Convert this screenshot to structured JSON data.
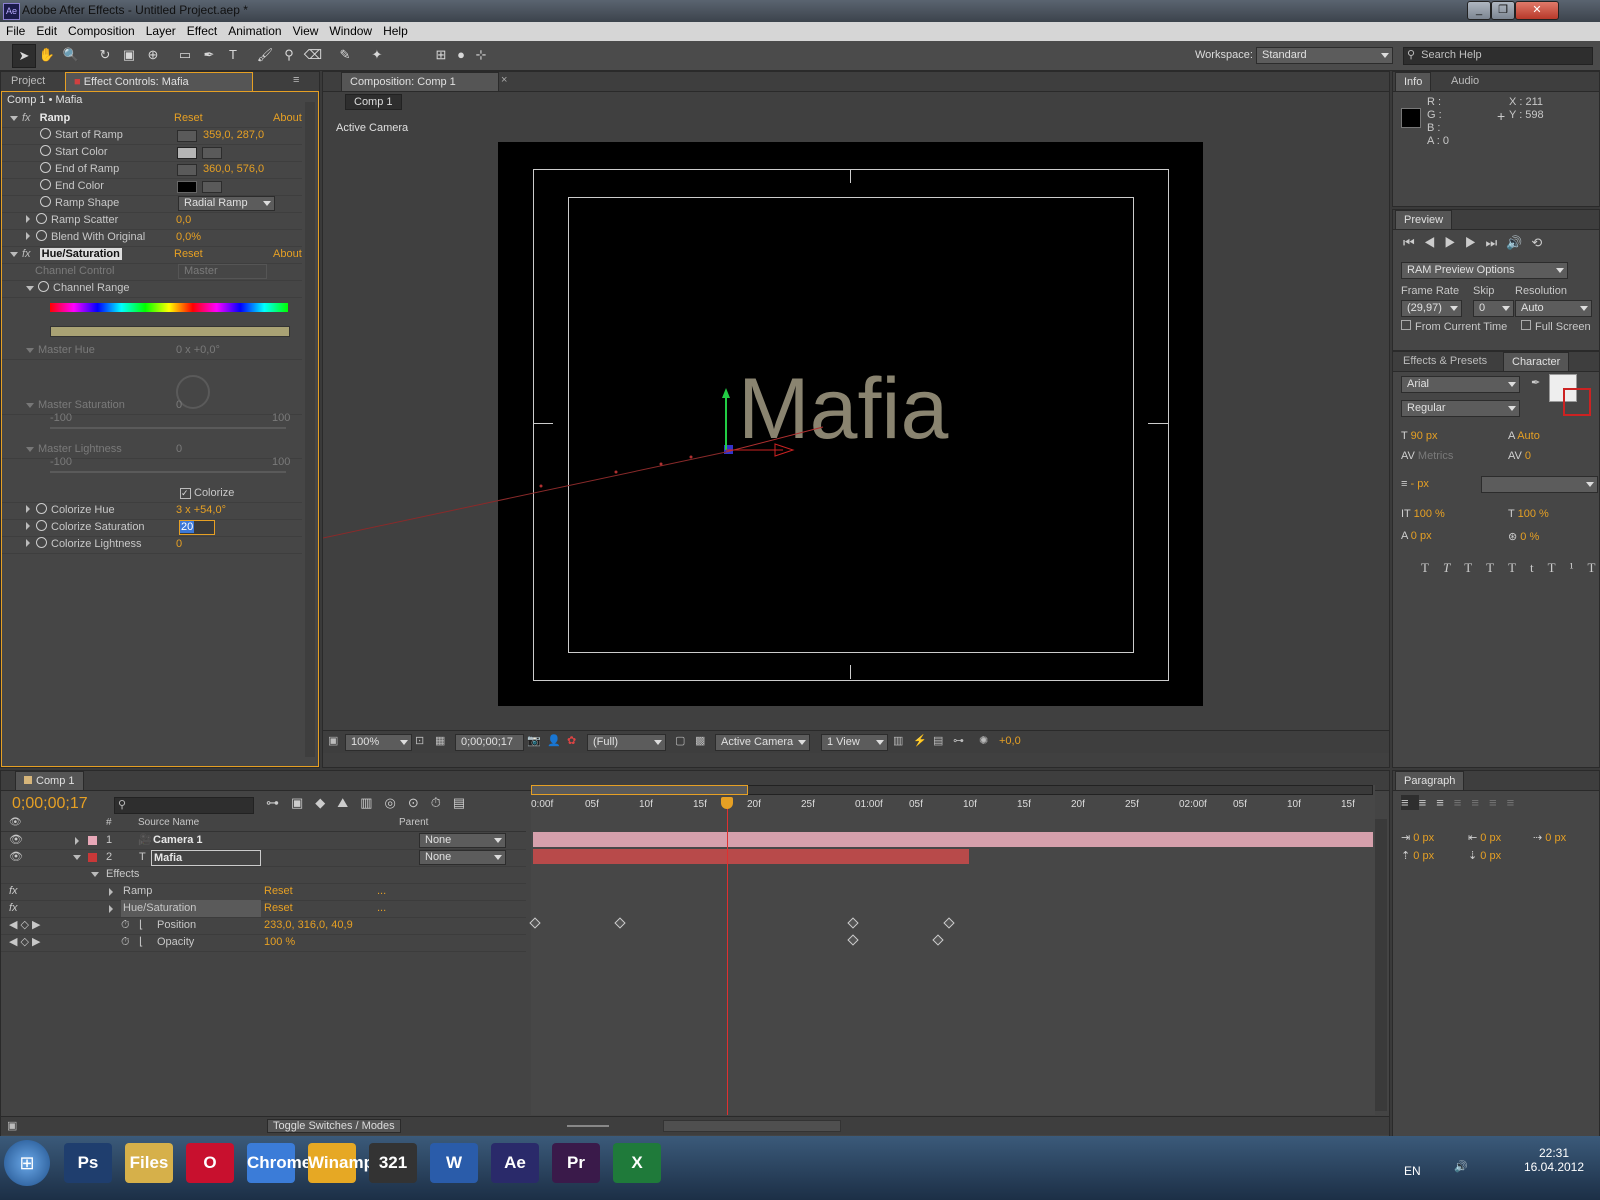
{
  "window": {
    "title": "Adobe After Effects - Untitled Project.aep *",
    "app_icon": "Ae"
  },
  "menu": [
    "File",
    "Edit",
    "Composition",
    "Layer",
    "Effect",
    "Animation",
    "View",
    "Window",
    "Help"
  ],
  "workspace": {
    "label": "Workspace:",
    "value": "Standard"
  },
  "search_help": {
    "placeholder": "Search Help"
  },
  "left_panel": {
    "tab_project": "Project",
    "tab_effect_controls": "Effect Controls: Mafia",
    "breadcrumb": "Comp 1 • Mafia",
    "ramp": {
      "name": "Ramp",
      "reset": "Reset",
      "about": "About",
      "start_of_ramp": {
        "label": "Start of Ramp",
        "value": "359,0, 287,0"
      },
      "start_color": {
        "label": "Start Color",
        "color": "#b5b5b5"
      },
      "end_of_ramp": {
        "label": "End of Ramp",
        "value": "360,0, 576,0"
      },
      "end_color": {
        "label": "End Color",
        "color": "#000000"
      },
      "ramp_shape": {
        "label": "Ramp Shape",
        "value": "Radial Ramp"
      },
      "ramp_scatter": {
        "label": "Ramp Scatter",
        "value": "0,0"
      },
      "blend": {
        "label": "Blend With Original",
        "value": "0,0%"
      }
    },
    "hue": {
      "name": "Hue/Saturation",
      "reset": "Reset",
      "about": "About",
      "channel_control": {
        "label": "Channel Control",
        "value": "Master"
      },
      "channel_range": "Channel Range",
      "master_hue": {
        "label": "Master Hue",
        "value": "0 x +0,0°"
      },
      "master_saturation": {
        "label": "Master Saturation",
        "value": "0",
        "min": "-100",
        "max": "100"
      },
      "master_lightness": {
        "label": "Master Lightness",
        "value": "0",
        "min": "-100",
        "max": "100"
      },
      "colorize": "Colorize",
      "colorize_hue": {
        "label": "Colorize Hue",
        "value": "3 x +54,0°"
      },
      "colorize_saturation": {
        "label": "Colorize Saturation",
        "value": "20"
      },
      "colorize_lightness": {
        "label": "Colorize Lightness",
        "value": "0"
      }
    }
  },
  "composition": {
    "tab": "Composition: Comp 1",
    "subtab": "Comp 1",
    "camera_label": "Active Camera",
    "text": "Mafia",
    "text_color": "#8a8470",
    "bottom": {
      "zoom": "100%",
      "timecode": "0;00;00;17",
      "resolution": "(Full)",
      "camera": "Active Camera",
      "view": "1 View",
      "exposure": "+0,0"
    }
  },
  "info": {
    "tab_info": "Info",
    "tab_audio": "Audio",
    "r": "R :",
    "g": "G :",
    "b": "B :",
    "a": "A : 0",
    "x": "X : 211",
    "y": "Y : 598"
  },
  "preview": {
    "tab": "Preview",
    "ram_options": "RAM Preview Options",
    "frame_rate_label": "Frame Rate",
    "frame_rate": "(29,97)",
    "skip_label": "Skip",
    "skip": "0",
    "resolution_label": "Resolution",
    "resolution": "Auto",
    "from_current": "From Current Time",
    "full_screen": "Full Screen"
  },
  "character": {
    "tab_effects": "Effects & Presets",
    "tab_char": "Character",
    "font": "Arial",
    "style": "Regular",
    "size": "90 px",
    "leading": "Auto",
    "kerning": "Metrics",
    "tracking": "0",
    "stroke": "- px",
    "vscale": "100 %",
    "hscale": "100 %",
    "baseline": "0 px",
    "tsume": "0 %"
  },
  "paragraph": {
    "tab": "Paragraph",
    "v1": "0 px",
    "v2": "0 px",
    "v3": "0 px",
    "v4": "0 px",
    "v5": "0 px"
  },
  "timeline": {
    "tab": "Comp 1",
    "timecode": "0;00;00;17",
    "col_num": "#",
    "col_source": "Source Name",
    "col_parent": "Parent",
    "ruler": [
      "0:00f",
      "05f",
      "10f",
      "15f",
      "20f",
      "25f",
      "01:00f",
      "05f",
      "10f",
      "15f",
      "20f",
      "25f",
      "02:00f",
      "05f",
      "10f",
      "15f"
    ],
    "layers": [
      {
        "num": "1",
        "name": "Camera 1",
        "parent": "None",
        "color": "#e8a8b8"
      },
      {
        "num": "2",
        "name": "Mafia",
        "parent": "None",
        "color": "#c83838"
      }
    ],
    "effects_label": "Effects",
    "ramp": "Ramp",
    "hue": "Hue/Saturation",
    "reset": "Reset",
    "dots": "...",
    "position": {
      "label": "Position",
      "value": "233,0, 316,0, 40,9"
    },
    "opacity": {
      "label": "Opacity",
      "value": "100 %"
    },
    "toggle": "Toggle Switches / Modes"
  },
  "taskbar": {
    "apps": [
      "Ps",
      "Files",
      "O",
      "Chrome",
      "Winamp",
      "321",
      "W",
      "Ae",
      "Pr",
      "X"
    ],
    "lang": "EN",
    "time": "22:31",
    "date": "16.04.2012"
  }
}
